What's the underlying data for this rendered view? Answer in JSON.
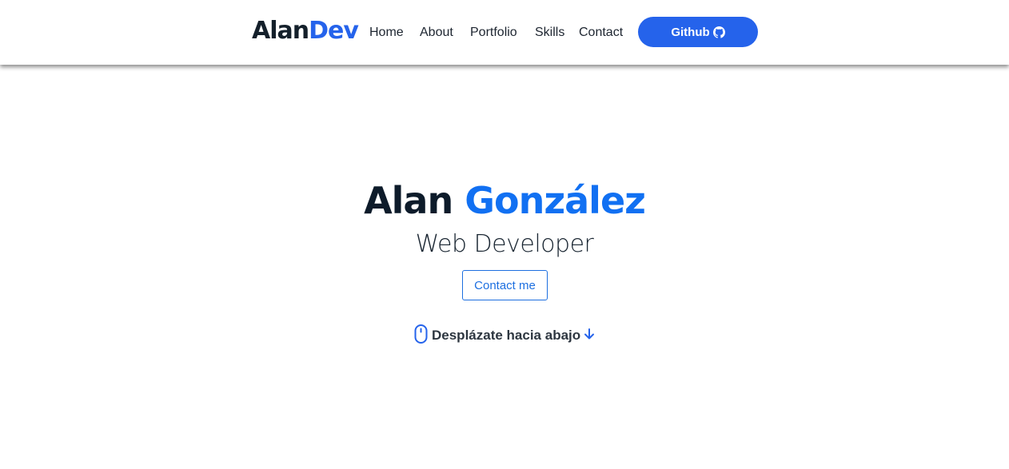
{
  "header": {
    "logo": {
      "part_1": "Alan",
      "part_2": "Dev"
    },
    "nav": [
      {
        "label": "Home"
      },
      {
        "label": "About"
      },
      {
        "label": "Portfolio"
      },
      {
        "label": "Skills"
      },
      {
        "label": "Contact"
      }
    ],
    "github_button": {
      "label": "Github",
      "icon": "github-icon"
    }
  },
  "hero": {
    "first_name": "Alan",
    "last_name": "González",
    "role": "Web Developer",
    "contact_button": "Contact me",
    "scroll_hint": {
      "label": "Desplázate hacia abajo",
      "leading_icon": "mouse-icon",
      "trailing_icon": "arrow-down-icon"
    }
  },
  "colors": {
    "accent": "#2563eb",
    "name_accent": "#1170f2",
    "dark": "#0d1b2a",
    "background": "#ffffff"
  }
}
